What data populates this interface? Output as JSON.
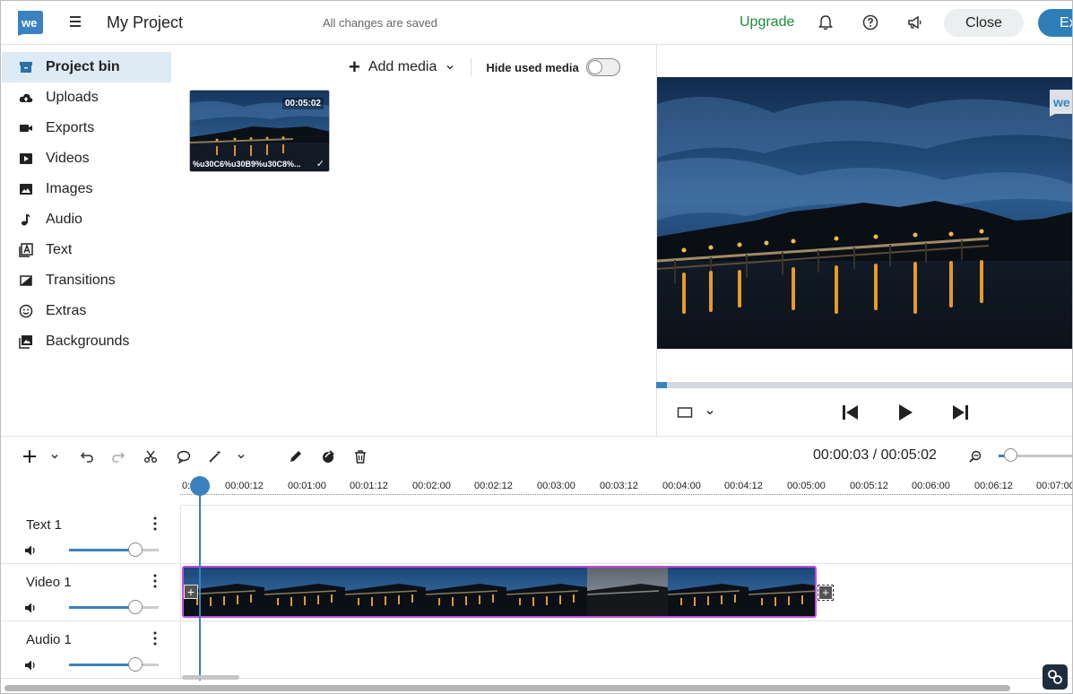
{
  "header": {
    "title": "My Project",
    "saved_status": "All changes are saved",
    "upgrade_label": "Upgrade",
    "close_label": "Close",
    "export_label": "Ex",
    "icons": [
      "bell-icon",
      "help-icon",
      "megaphone-icon"
    ]
  },
  "sidebar": {
    "items": [
      {
        "label": "Project bin",
        "icon": "project-bin-icon",
        "active": true
      },
      {
        "label": "Uploads",
        "icon": "cloud-upload-icon"
      },
      {
        "label": "Exports",
        "icon": "video-camera-icon"
      },
      {
        "label": "Videos",
        "icon": "video-icon"
      },
      {
        "label": "Images",
        "icon": "image-icon"
      },
      {
        "label": "Audio",
        "icon": "music-note-icon"
      },
      {
        "label": "Text",
        "icon": "text-icon"
      },
      {
        "label": "Transitions",
        "icon": "transition-icon"
      },
      {
        "label": "Extras",
        "icon": "smiley-icon"
      },
      {
        "label": "Backgrounds",
        "icon": "backgrounds-icon"
      }
    ]
  },
  "media_bin": {
    "add_media_label": "Add media",
    "hide_used_label": "Hide used media",
    "hide_used_on": false,
    "items": [
      {
        "name": "%u30C6%u30B9%u30C8%...",
        "duration": "00:05:02",
        "used": true
      }
    ]
  },
  "preview": {
    "progress_fraction": 0.01
  },
  "toolbar": {
    "timecode": "00:00:03 / 00:05:02",
    "zoom_level_fraction": 0.1
  },
  "ruler": {
    "ticks": [
      "0:",
      "00:00:12",
      "00:01:00",
      "00:01:12",
      "00:02:00",
      "00:02:12",
      "00:03:00",
      "00:03:12",
      "00:04:00",
      "00:04:12",
      "00:05:00",
      "00:05:12",
      "00:06:00",
      "00:06:12",
      "00:07:00"
    ]
  },
  "tracks": [
    {
      "name": "Text 1",
      "volume_fraction": 0.72
    },
    {
      "name": "Video 1",
      "volume_fraction": 0.72
    },
    {
      "name": "Audio 1",
      "volume_fraction": 0.72
    }
  ],
  "colors": {
    "accent": "#3a82bf",
    "upgrade": "#1d8a3a",
    "clip_border": "#c04ddc",
    "active_sidebar": "#deeaf4"
  }
}
